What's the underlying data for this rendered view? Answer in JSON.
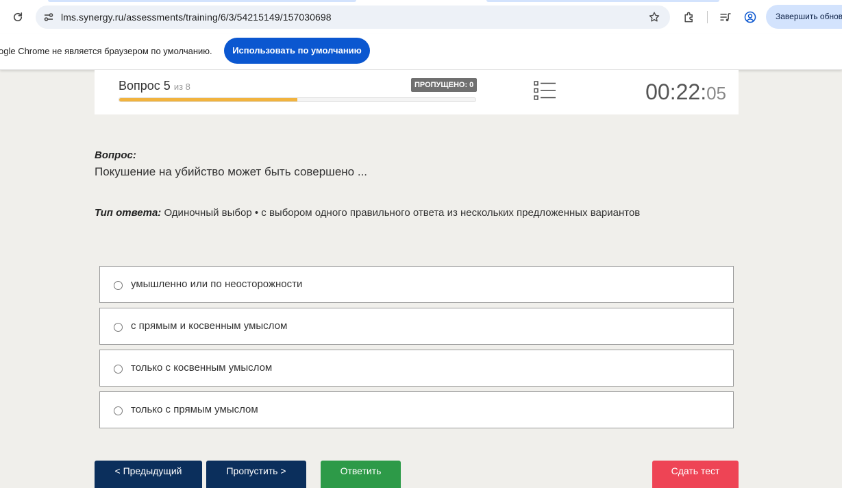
{
  "browser": {
    "url": "lms.synergy.ru/assessments/training/6/3/54215149/157030698",
    "update_label": "Завершить обновление",
    "icons": [
      "reload-icon",
      "site-info-icon",
      "star-icon",
      "extensions-icon",
      "media-icon",
      "profile-icon"
    ]
  },
  "infobar": {
    "message": "ogle Chrome не является браузером по умолчанию.",
    "button_label": "Использовать по умолчанию"
  },
  "test": {
    "question_label": "Вопрос 5",
    "question_of": "из 8",
    "progress_fraction": 0.5,
    "skipped_label": "ПРОПУЩЕНО: 0",
    "timer_main": "00:22:",
    "timer_seconds": "05"
  },
  "question": {
    "heading": "Вопрос:",
    "text": "Покушение на убийство может быть совершено ...",
    "answer_type_label": "Тип ответа:",
    "answer_type_value": "Одиночный выбор • с выбором одного правильного ответа из нескольких предложенных вариантов"
  },
  "options": [
    {
      "label": "умышленно или по неосторожности"
    },
    {
      "label": "с прямым и косвенным умыслом"
    },
    {
      "label": "только с косвенным умыслом"
    },
    {
      "label": "только с прямым умыслом"
    }
  ],
  "buttons": {
    "prev": "< Предыдущий",
    "skip": "Пропустить >",
    "answer": "Ответить",
    "finish": "Сдать тест"
  },
  "colors": {
    "accent_blue": "#0b57d0",
    "progress": "#f1b33f",
    "nav_button": "#0b2f5c",
    "answer_button": "#2d9a48",
    "finish_button": "#ee4455"
  }
}
